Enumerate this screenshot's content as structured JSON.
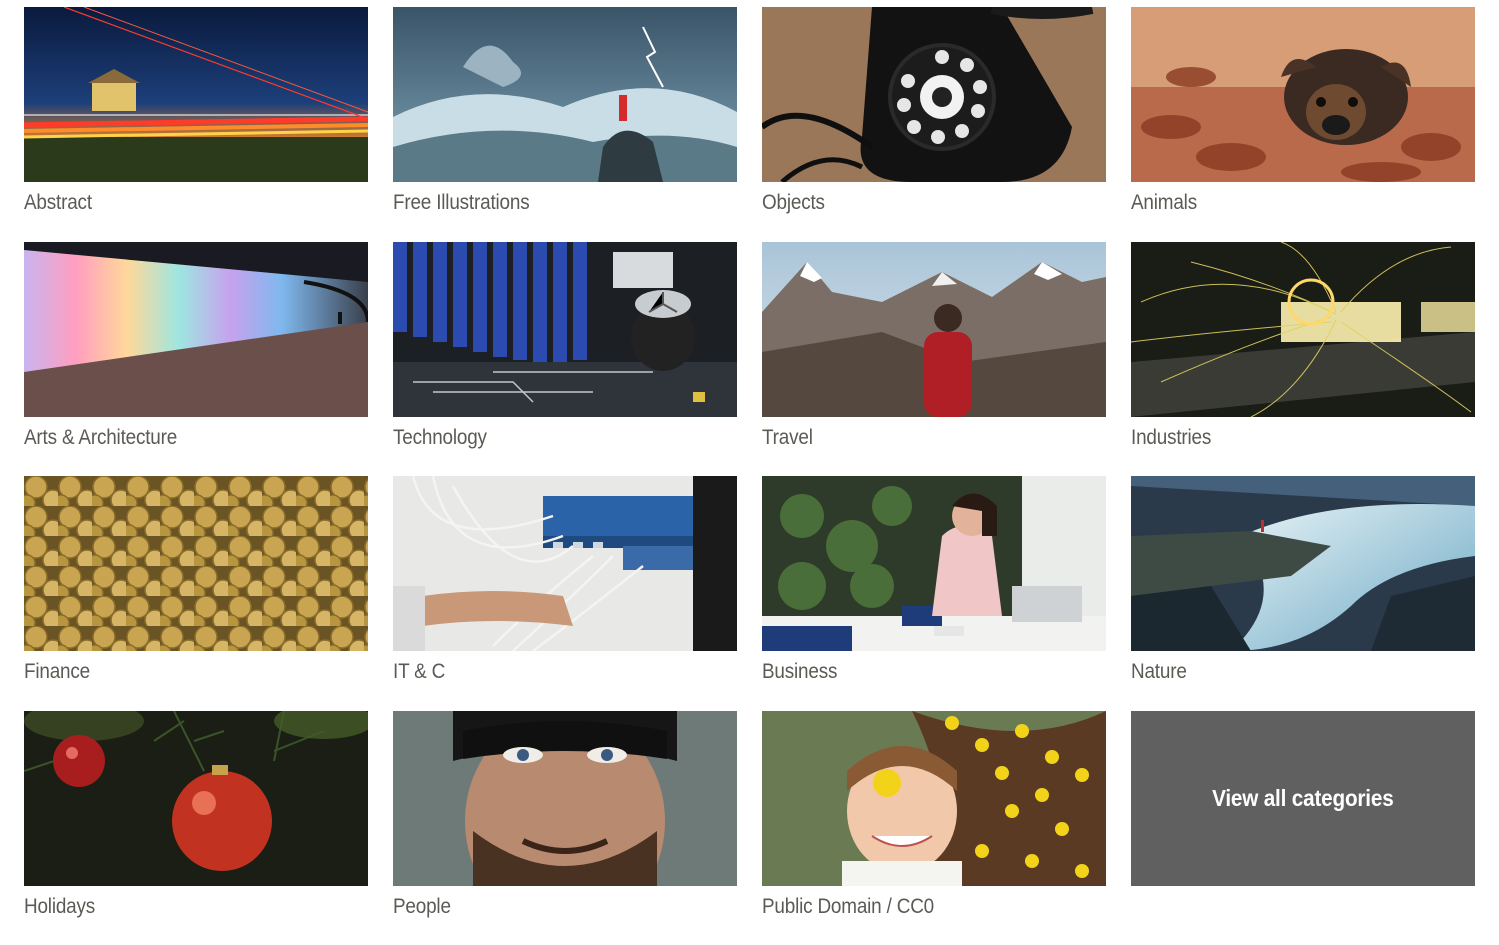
{
  "categories": [
    {
      "label": "Abstract",
      "scene": "abstract"
    },
    {
      "label": "Free Illustrations",
      "scene": "illustrations"
    },
    {
      "label": "Objects",
      "scene": "objects"
    },
    {
      "label": "Animals",
      "scene": "animals"
    },
    {
      "label": "Arts & Architecture",
      "scene": "architecture"
    },
    {
      "label": "Technology",
      "scene": "technology"
    },
    {
      "label": "Travel",
      "scene": "travel"
    },
    {
      "label": "Industries",
      "scene": "industries"
    },
    {
      "label": "Finance",
      "scene": "finance"
    },
    {
      "label": "IT & C",
      "scene": "itc"
    },
    {
      "label": "Business",
      "scene": "business"
    },
    {
      "label": "Nature",
      "scene": "nature"
    },
    {
      "label": "Holidays",
      "scene": "holidays"
    },
    {
      "label": "People",
      "scene": "people"
    },
    {
      "label": "Public Domain / CC0",
      "scene": "publicdomain"
    }
  ],
  "view_all": {
    "label": "View all categories"
  },
  "colors": {
    "label_text": "#5b5b55",
    "view_all_bg": "#606060",
    "view_all_text": "#ffffff"
  }
}
